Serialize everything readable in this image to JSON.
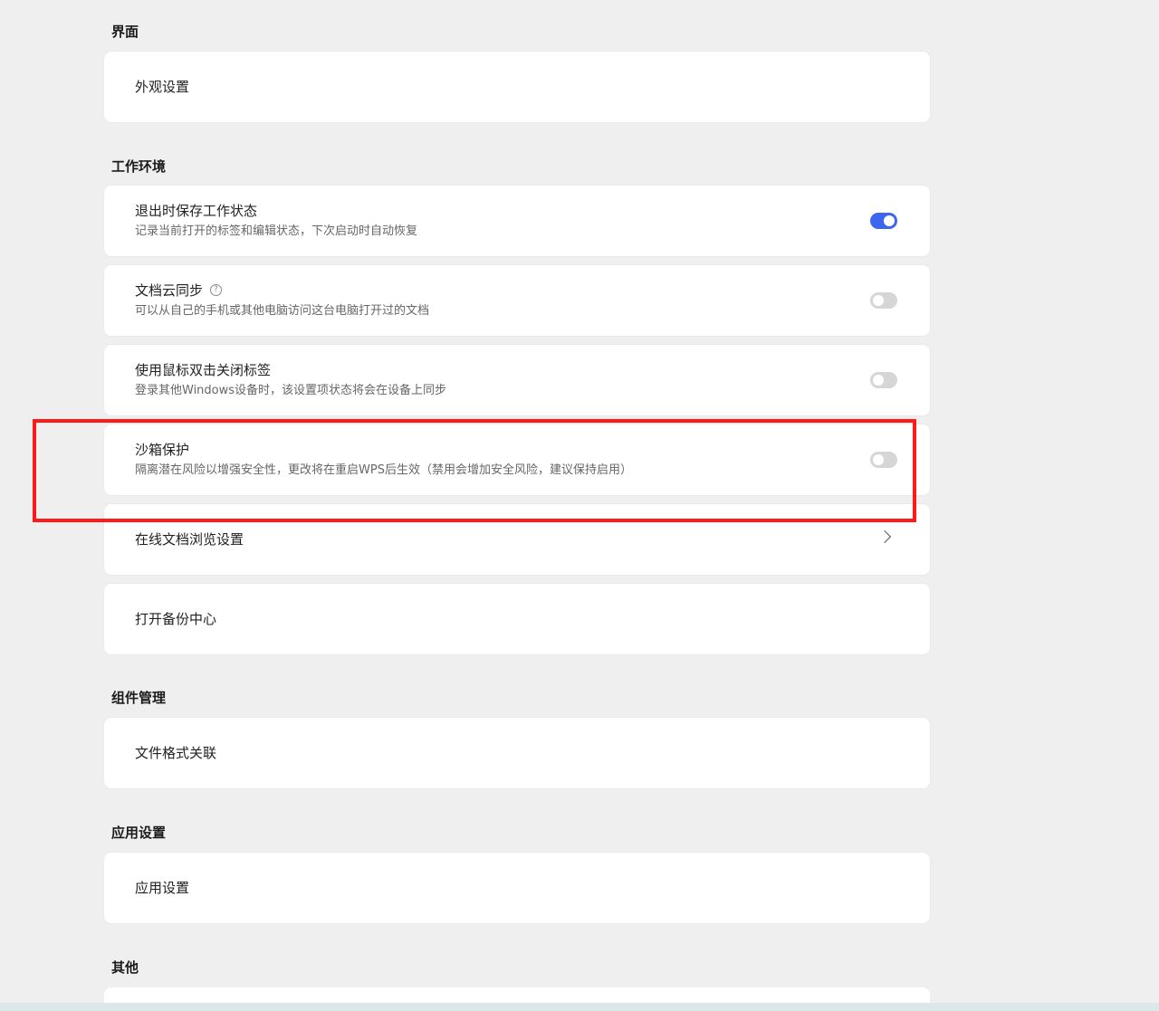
{
  "sections": {
    "interface": {
      "title": "界面",
      "item": "外观设置"
    },
    "workspace": {
      "title": "工作环境",
      "items": [
        {
          "title": "退出时保存工作状态",
          "description": "记录当前打开的标签和编辑状态，下次启动时自动恢复",
          "toggle": "on"
        },
        {
          "title": "文档云同步",
          "description": "可以从自己的手机或其他电脑访问这台电脑打开过的文档",
          "toggle": "off",
          "icon": "help-icon"
        },
        {
          "title": "使用鼠标双击关闭标签",
          "description": "登录其他Windows设备时，该设置项状态将会在设备上同步",
          "toggle": "off"
        },
        {
          "title": "沙箱保护",
          "description": "隔离潜在风险以增强安全性，更改将在重启WPS后生效（禁用会增加安全风险，建议保持启用）",
          "toggle": "off"
        },
        {
          "title": "在线文档浏览设置",
          "icon": "chevron-right-icon"
        },
        {
          "title": "打开备份中心"
        }
      ]
    },
    "components": {
      "title": "组件管理",
      "item": "文件格式关联"
    },
    "app_settings": {
      "title": "应用设置",
      "item": "应用设置"
    },
    "other": {
      "title": "其他"
    }
  },
  "colors": {
    "background": "#efefef",
    "card": "#ffffff",
    "toggle_on": "#3c66f0",
    "toggle_off": "#d6d6d6",
    "highlight": "#ff1a1a"
  }
}
